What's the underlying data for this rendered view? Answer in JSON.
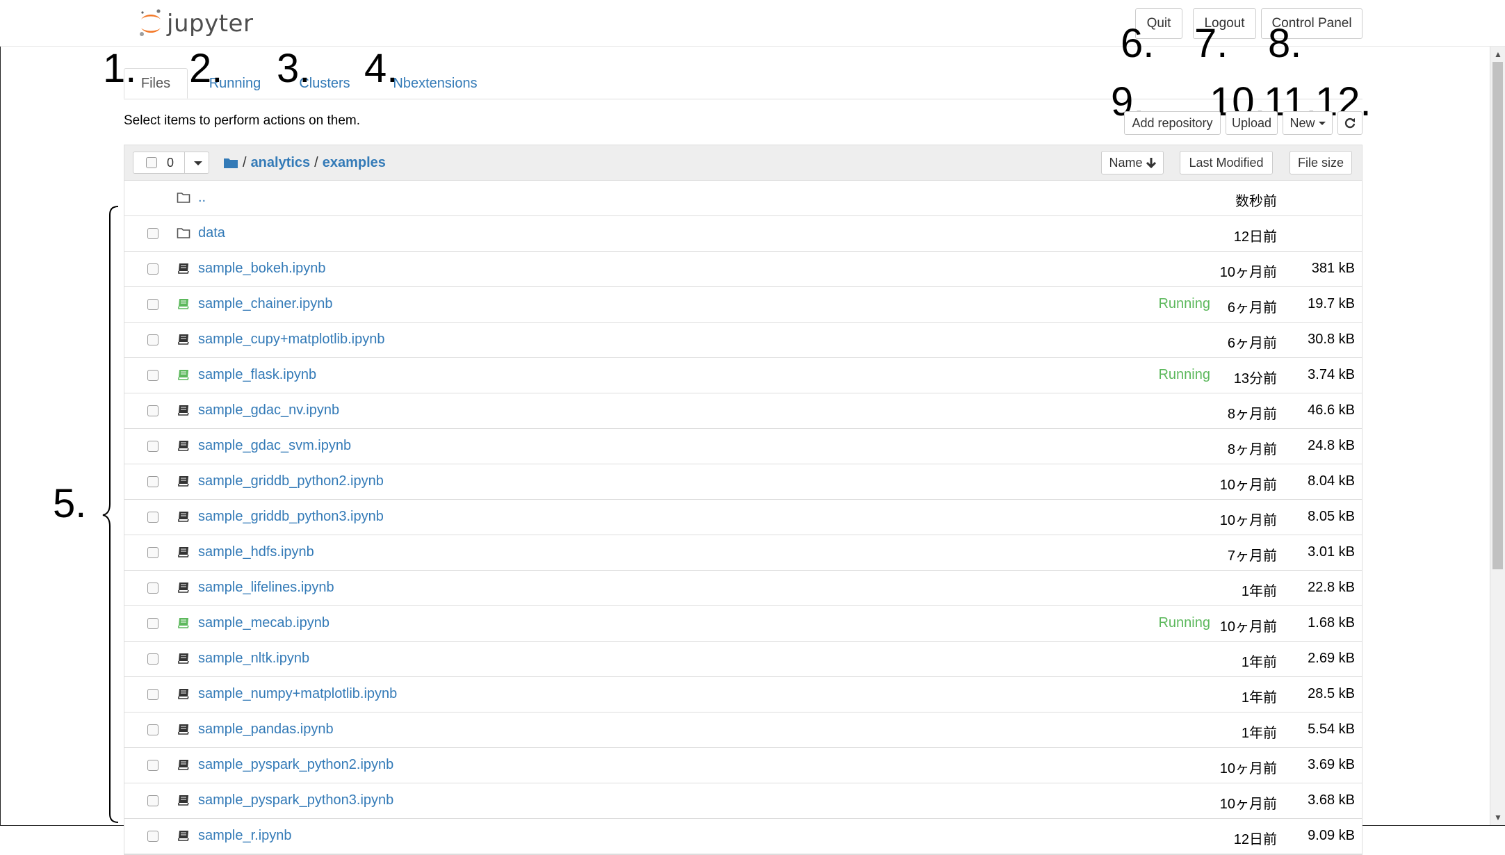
{
  "header": {
    "logo_text": "jupyter",
    "buttons": {
      "quit": "Quit",
      "logout": "Logout",
      "control_panel": "Control Panel"
    }
  },
  "tabs": [
    "Files",
    "Running",
    "Clusters",
    "Nbextensions"
  ],
  "annotations": [
    "1.",
    "2.",
    "3.",
    "4.",
    "5.",
    "6.",
    "7.",
    "8.",
    "9.",
    "10.",
    "11.",
    "12."
  ],
  "toolbar": {
    "instruction": "Select items to perform actions on them.",
    "add_repository": "Add repository",
    "upload": "Upload",
    "new": "New",
    "refresh_icon": "refresh-icon"
  },
  "list_header": {
    "selected_count": "0",
    "breadcrumb": [
      "analytics",
      "examples"
    ],
    "sort_name": "Name",
    "sort_modified": "Last Modified",
    "sort_size": "File size"
  },
  "colors": {
    "link": "#337ab7",
    "running": "#5cb85c",
    "notebook_icon": "#333333"
  },
  "rows": [
    {
      "type": "parent",
      "name": "..",
      "status": "",
      "modified": "数秒前",
      "size": ""
    },
    {
      "type": "folder",
      "name": "data",
      "status": "",
      "modified": "12日前",
      "size": ""
    },
    {
      "type": "notebook",
      "name": "sample_bokeh.ipynb",
      "status": "",
      "modified": "10ヶ月前",
      "size": "381 kB"
    },
    {
      "type": "notebook-running",
      "name": "sample_chainer.ipynb",
      "status": "Running",
      "modified": "6ヶ月前",
      "size": "19.7 kB"
    },
    {
      "type": "notebook",
      "name": "sample_cupy+matplotlib.ipynb",
      "status": "",
      "modified": "6ヶ月前",
      "size": "30.8 kB"
    },
    {
      "type": "notebook-running",
      "name": "sample_flask.ipynb",
      "status": "Running",
      "modified": "13分前",
      "size": "3.74 kB"
    },
    {
      "type": "notebook",
      "name": "sample_gdac_nv.ipynb",
      "status": "",
      "modified": "8ヶ月前",
      "size": "46.6 kB"
    },
    {
      "type": "notebook",
      "name": "sample_gdac_svm.ipynb",
      "status": "",
      "modified": "8ヶ月前",
      "size": "24.8 kB"
    },
    {
      "type": "notebook",
      "name": "sample_griddb_python2.ipynb",
      "status": "",
      "modified": "10ヶ月前",
      "size": "8.04 kB"
    },
    {
      "type": "notebook",
      "name": "sample_griddb_python3.ipynb",
      "status": "",
      "modified": "10ヶ月前",
      "size": "8.05 kB"
    },
    {
      "type": "notebook",
      "name": "sample_hdfs.ipynb",
      "status": "",
      "modified": "7ヶ月前",
      "size": "3.01 kB"
    },
    {
      "type": "notebook",
      "name": "sample_lifelines.ipynb",
      "status": "",
      "modified": "1年前",
      "size": "22.8 kB"
    },
    {
      "type": "notebook-running",
      "name": "sample_mecab.ipynb",
      "status": "Running",
      "modified": "10ヶ月前",
      "size": "1.68 kB"
    },
    {
      "type": "notebook",
      "name": "sample_nltk.ipynb",
      "status": "",
      "modified": "1年前",
      "size": "2.69 kB"
    },
    {
      "type": "notebook",
      "name": "sample_numpy+matplotlib.ipynb",
      "status": "",
      "modified": "1年前",
      "size": "28.5 kB"
    },
    {
      "type": "notebook",
      "name": "sample_pandas.ipynb",
      "status": "",
      "modified": "1年前",
      "size": "5.54 kB"
    },
    {
      "type": "notebook",
      "name": "sample_pyspark_python2.ipynb",
      "status": "",
      "modified": "10ヶ月前",
      "size": "3.69 kB"
    },
    {
      "type": "notebook",
      "name": "sample_pyspark_python3.ipynb",
      "status": "",
      "modified": "10ヶ月前",
      "size": "3.68 kB"
    },
    {
      "type": "notebook",
      "name": "sample_r.ipynb",
      "status": "",
      "modified": "12日前",
      "size": "9.09 kB"
    }
  ]
}
